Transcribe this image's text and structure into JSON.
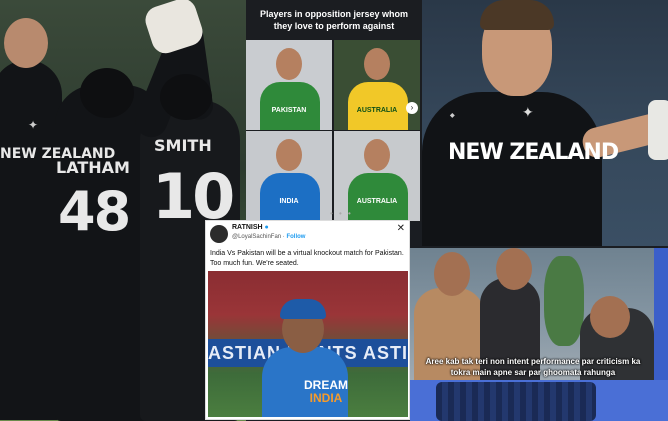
{
  "left_photo": {
    "jersey_country": "NEW ZEALAND",
    "player_name_1": "LATHAM",
    "player_number_1": "48",
    "player_name_2": "SMITH",
    "player_number_2": "10"
  },
  "poster": {
    "title": "Players in opposition jersey whom they love to perform against",
    "cells": [
      {
        "jersey": "PAKISTAN"
      },
      {
        "jersey": "AUSTRALIA"
      },
      {
        "jersey": "INDIA"
      },
      {
        "jersey": "AUSTRALIA"
      }
    ],
    "next_icon": "chevron-right-icon"
  },
  "right_photo": {
    "jersey_text": "NEW ZEALAND"
  },
  "tweet": {
    "display_name": "RATNISH",
    "handle": "@LoyalSachinFan",
    "follow_label": "Follow",
    "text": "India Vs Pakistan will be a virtual knockout match for Pakistan. Too much fun. We're seated.",
    "ad_board_text": "ASTIAN PAINTS   ASTI",
    "image_jersey_line1": "DREAM",
    "image_jersey_line2": "INDIA",
    "close_icon": "close-icon"
  },
  "meme": {
    "caption": "Aree kab tak teri non intent performance par criticism ka tokra main apne sar par ghoomata rahunga"
  }
}
